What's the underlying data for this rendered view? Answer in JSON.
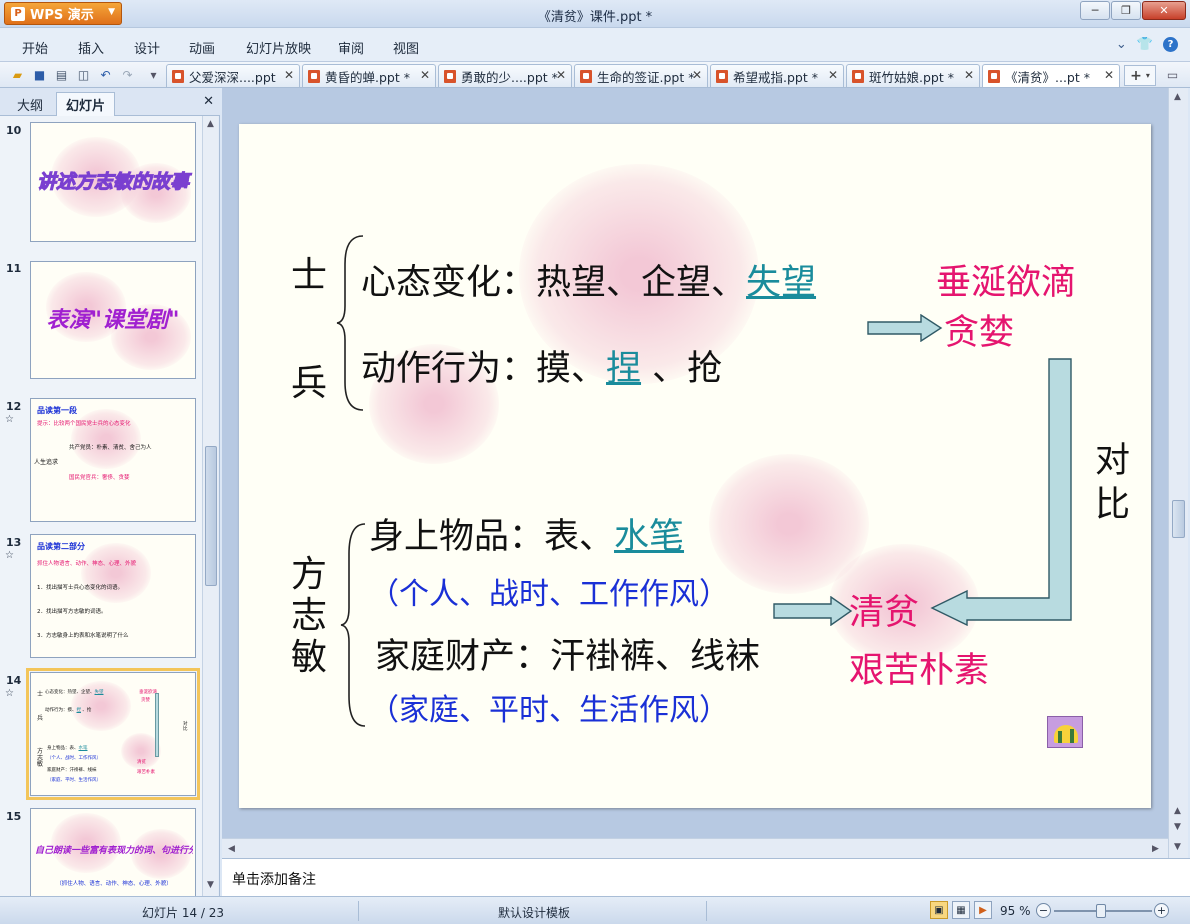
{
  "window": {
    "app_button": "WPS 演示",
    "title": "《清贫》课件.ppt *"
  },
  "menu": [
    "开始",
    "插入",
    "设计",
    "动画",
    "幻灯片放映",
    "审阅",
    "视图"
  ],
  "doc_tabs": [
    {
      "label": "父爱深深....ppt"
    },
    {
      "label": "黄昏的蝉.ppt *"
    },
    {
      "label": "勇敢的少....ppt *"
    },
    {
      "label": "生命的签证.ppt *"
    },
    {
      "label": "希望戒指.ppt *"
    },
    {
      "label": "斑竹姑娘.ppt *"
    },
    {
      "label": "《清贫》...pt *"
    }
  ],
  "left_pane": {
    "tab_outline": "大纲",
    "tab_slides": "幻灯片"
  },
  "thumbnails": [
    {
      "num": "10",
      "text": "讲述方志敏的故事"
    },
    {
      "num": "11",
      "text": "表演\"课堂剧\""
    },
    {
      "num": "12",
      "title": "品读第一段",
      "line1": "提示：比较两个国民党士兵的心态变化",
      "l_root": "人生追求",
      "l_a": "共产党员：朴素、清贫、舍己为人",
      "l_b": "国民党官兵：奢侈、贪婪"
    },
    {
      "num": "13",
      "title": "品读第二部分",
      "line1": "抓住人物语言、动作、神态、心理、外貌",
      "p1": "1．找出描写士兵心态变化的词语。",
      "p2": "2．找出描写方志敏的词语。",
      "p3": "3．方志敏身上的表和水笔说明了什么"
    },
    {
      "num": "14"
    },
    {
      "num": "15",
      "text": "自己朗读一些富有表现力的词、句进行分析",
      "sub": "（抓住人物、语言、动作、神态、心理、外貌）"
    }
  ],
  "slide": {
    "soldier_label_1": "士",
    "soldier_label_2": "兵",
    "line_mood_prefix": "心态变化：热望、企望、",
    "line_mood_link": "失望",
    "line_action_prefix": "动作行为：摸、",
    "line_action_link": "捏",
    "line_action_suffix": " 、抢",
    "greed_1": "垂涎欲滴",
    "greed_2": "贪婪",
    "contrast_1": "对",
    "contrast_2": "比",
    "fang_1": "方",
    "fang_2": "志",
    "fang_3": "敏",
    "line_items_prefix": "身上物品：表、",
    "line_items_link": "水笔",
    "line_items_note": "（个人、战时、工作作风）",
    "line_property": "家庭财产：汗褂裤、线袜",
    "line_property_note": "（家庭、平时、生活作风）",
    "result_1": "清贫",
    "result_2": "艰苦朴素"
  },
  "notes_placeholder": "单击添加备注",
  "status": {
    "slide_counter": "幻灯片 14 / 23",
    "template": "默认设计模板",
    "zoom": "95 %"
  },
  "colors": {
    "teal": "#1a8c9c",
    "blue": "#1a30d6",
    "pink": "#e5156f",
    "arrow_fill": "#b8dbe0",
    "slide_bg": "#fffff6"
  }
}
